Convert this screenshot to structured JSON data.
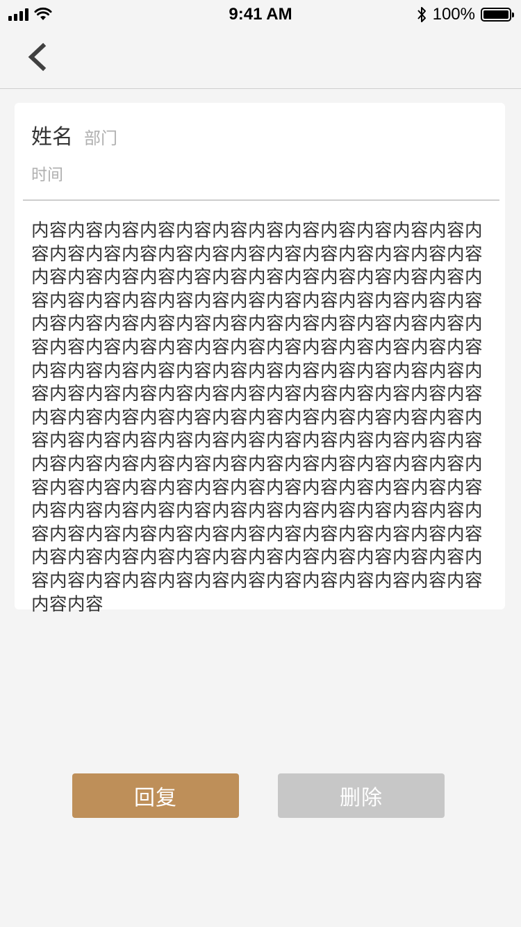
{
  "status_bar": {
    "time": "9:41 AM",
    "battery": "100%"
  },
  "nav": {
    "back_icon": "chevron-left-icon"
  },
  "message": {
    "name": "姓名",
    "department": "部门",
    "time": "时间",
    "content": "内容内容内容内容内容内容内容内容内容内容内容内容内容内容内容内容内容内容内容内容内容内容内容内容内容内容内容内容内容内容内容内容内容内容内容内容内容内容内容内容内容内容内容内容内容内容内容内容内容内容内容内容内容内容内容内容内容内容内容内容内容内容内容内容内容内容内容内容内容内容内容内容内容内容内容内容内容内容内容内容内容内容内容内容内容内容内容内容内容内容内容内容内容内容内容内容内容内容内容内容内容内容内容内容内容内容内容内容内容内容内容内容内容内容内容内容内容内容内容内容内容内容内容内容内容内容内容内容内容内容内容内容内容内容内容内容内容内容内容内容内容内容内容内容内容内容内容内容内容内容内容内容内容内容内容内容内容内容内容内容内容内容内容内容内容内容内容内容内容内容内容内容内容内容内容内容内容内容内容内容内容内容内容内容内容内容内容内容内容内容内容内容内容内容内容内容内容内容内容内容内容内容"
  },
  "actions": {
    "reply_label": "回复",
    "delete_label": "删除"
  },
  "colors": {
    "reply_button": "#be8f59",
    "delete_button": "#c7c7c7",
    "background": "#f4f4f4"
  }
}
